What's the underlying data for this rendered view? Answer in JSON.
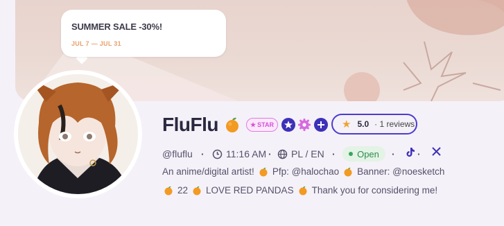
{
  "promo": {
    "title": "SUMMER SALE -30%!",
    "dates": "JUL 7 — JUL 31"
  },
  "profile": {
    "name": "FluFlu",
    "name_emoji": "orange-icon",
    "star_badge": "STAR",
    "rating": "5.0",
    "reviews": "· 1 reviews",
    "handle": "@fluflu",
    "time": "11:16 AM",
    "languages": "PL / EN",
    "status": "Open",
    "bio_line1": {
      "a": "An anime/digital artist!",
      "b": "Pfp: @halochao",
      "c": "Banner: @noesketch"
    },
    "bio_line2": {
      "a": "22",
      "b": "LOVE RED PANDAS",
      "c": "Thank you for considering me!"
    }
  },
  "colors": {
    "accent": "#4b3ccf",
    "star_badge": "#d64fd9",
    "gear_badge": "#d76ae0",
    "open": "#2f8d4f",
    "orange": "#f29a22"
  },
  "socials": [
    "tiktok-icon",
    "x-icon"
  ]
}
